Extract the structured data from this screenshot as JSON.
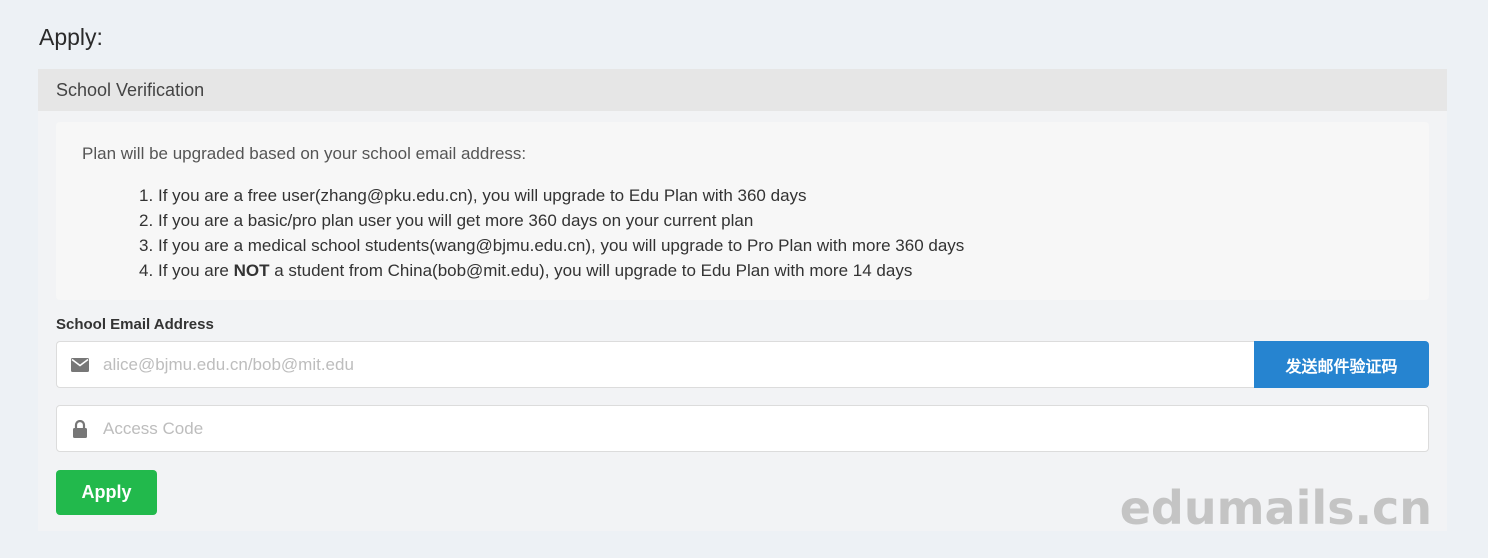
{
  "page": {
    "title": "Apply:"
  },
  "panel": {
    "heading": "School Verification",
    "intro": "Plan will be upgraded based on your school email address:",
    "items": [
      {
        "num": "1.",
        "pre": "If you are a free user(zhang@pku.edu.cn), you will upgrade to Edu Plan with 360 days",
        "bold": "",
        "post": ""
      },
      {
        "num": "2.",
        "pre": "If you are a basic/pro plan user you will get more 360 days on your current plan",
        "bold": "",
        "post": ""
      },
      {
        "num": "3.",
        "pre": "If you are a medical school students(wang@bjmu.edu.cn), you will upgrade to Pro Plan with more 360 days",
        "bold": "",
        "post": ""
      },
      {
        "num": "4.",
        "pre": "If you are ",
        "bold": "NOT",
        "post": " a student from China(bob@mit.edu), you will upgrade to Edu Plan with more 14 days"
      }
    ]
  },
  "form": {
    "email_label": "School Email Address",
    "email_placeholder": "alice@bjmu.edu.cn/bob@mit.edu",
    "email_icon": "envelope-icon",
    "send_button": "发送邮件验证码",
    "code_placeholder": "Access Code",
    "code_icon": "lock-icon",
    "apply_button": "Apply"
  },
  "watermark": "edumails.cn",
  "colors": {
    "send_button": "#2684d0",
    "apply_button": "#22b94c",
    "background": "#edf1f5"
  }
}
